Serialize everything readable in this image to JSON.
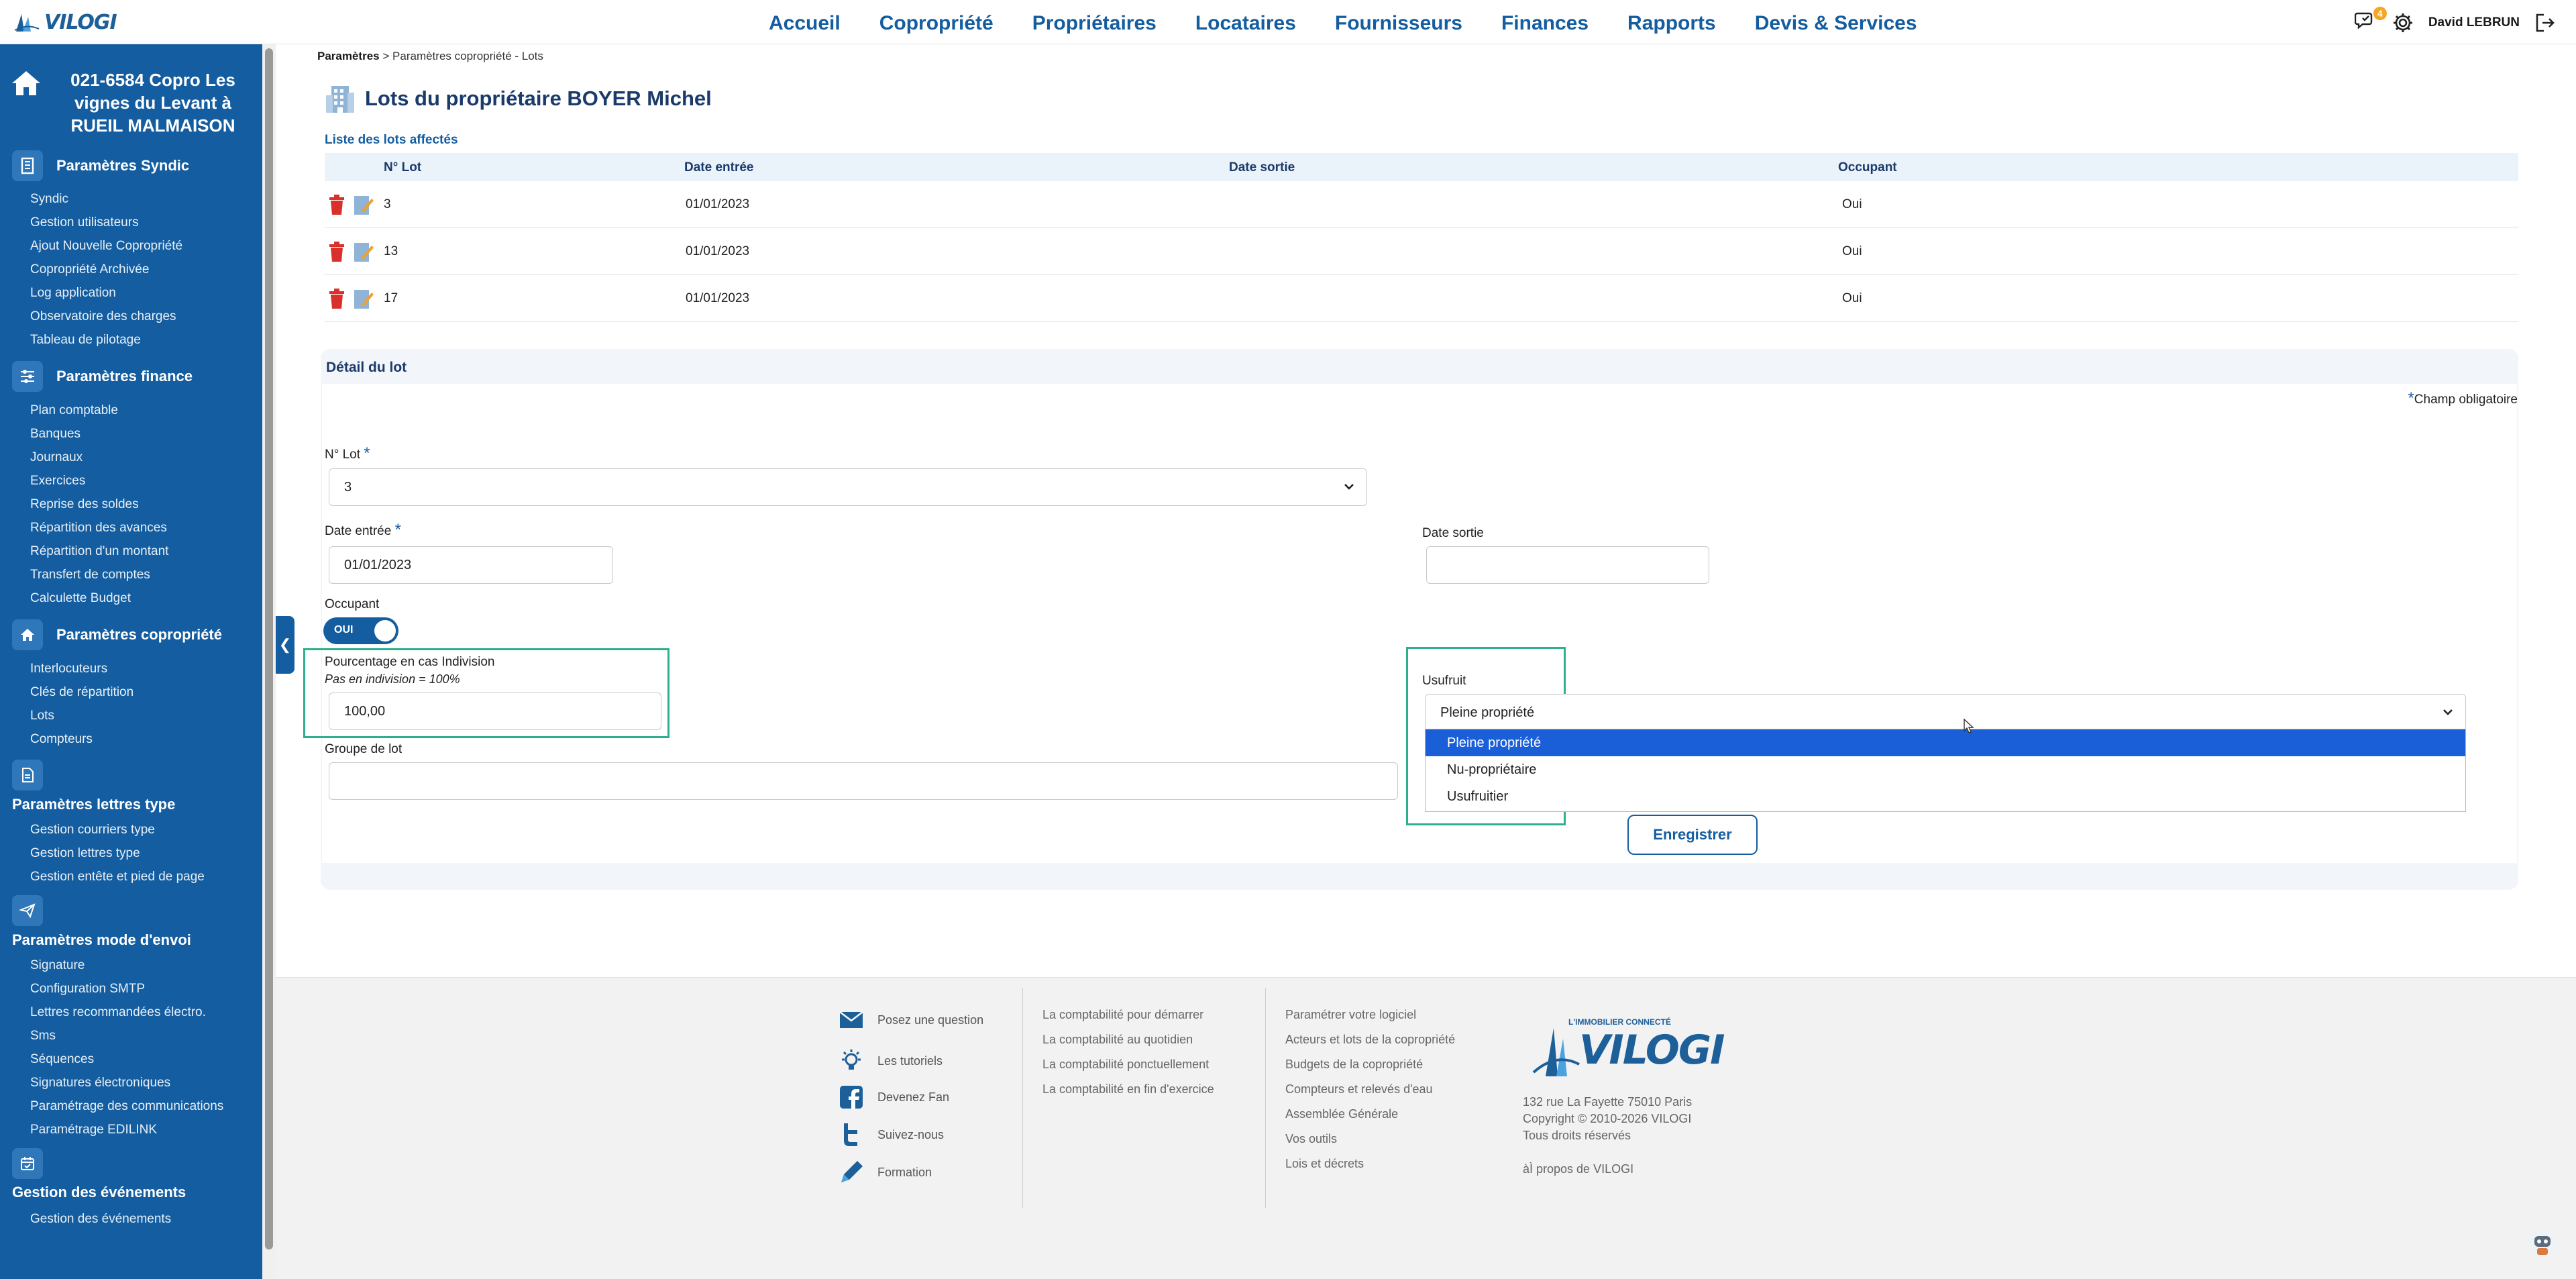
{
  "topnav": {
    "logo": "VILOGI",
    "items": [
      "Accueil",
      "Copropriété",
      "Propriétaires",
      "Locataires",
      "Fournisseurs",
      "Finances",
      "Rapports",
      "Devis & Services"
    ],
    "notification_count": "4",
    "user_name": "David LEBRUN"
  },
  "sidebar": {
    "copro_title": "021-6584 Copro Les vignes du Levant à RUEIL MALMAISON",
    "sections": [
      {
        "title": "Paramètres Syndic",
        "icon": "building-icon",
        "links": [
          "Syndic",
          "Gestion utilisateurs",
          "Ajout Nouvelle Copropriété",
          "Copropriété Archivée",
          "Log application",
          "Observatoire des charges",
          "Tableau de pilotage"
        ]
      },
      {
        "title": "Paramètres finance",
        "icon": "sliders-icon",
        "links": [
          "Plan comptable",
          "Banques",
          "Journaux",
          "Exercices",
          "Reprise des soldes",
          "Répartition des avances",
          "Répartition d'un montant",
          "Transfert de comptes",
          "Calculette Budget"
        ]
      },
      {
        "title": "Paramètres copropriété",
        "icon": "home-icon",
        "links": [
          "Interlocuteurs",
          "Clés de répartition",
          "Lots",
          "Compteurs"
        ]
      },
      {
        "title": "Paramètres lettres type",
        "icon": "document-icon",
        "links": [
          "Gestion courriers type",
          "Gestion lettres type",
          "Gestion entête et pied de page"
        ]
      },
      {
        "title": "Paramètres mode d'envoi",
        "icon": "send-icon",
        "links": [
          "Signature",
          "Configuration SMTP",
          "Lettres recommandées électro.",
          "Sms",
          "Séquences",
          "Signatures électroniques",
          "Paramétrage des communications",
          "Paramétrage EDILINK"
        ]
      },
      {
        "title": "Gestion des événements",
        "icon": "calendar-icon",
        "links": [
          "Gestion des événements"
        ]
      }
    ]
  },
  "breadcrumb": {
    "root": "Paramètres",
    "separator": ">",
    "current": "Paramètres copropriété - Lots"
  },
  "page_title": "Lots du propriétaire BOYER Michel",
  "lots_table": {
    "label": "Liste des lots affectés",
    "headers": [
      "N° Lot",
      "Date entrée",
      "Date sortie",
      "Occupant"
    ],
    "rows": [
      {
        "lot": "3",
        "date_entree": "01/01/2023",
        "date_sortie": "",
        "occupant": "Oui"
      },
      {
        "lot": "13",
        "date_entree": "01/01/2023",
        "date_sortie": "",
        "occupant": "Oui"
      },
      {
        "lot": "17",
        "date_entree": "01/01/2023",
        "date_sortie": "",
        "occupant": "Oui"
      }
    ]
  },
  "detail": {
    "title": "Détail du lot",
    "required_star": "*",
    "required_note": "Champ obligatoire",
    "lot_label": "N° Lot",
    "lot_value": "3",
    "date_entree_label": "Date entrée",
    "date_entree_value": "01/01/2023",
    "date_sortie_label": "Date sortie",
    "date_sortie_value": "",
    "occupant_label": "Occupant",
    "occupant_toggle": "OUI",
    "indivision_label": "Pourcentage en cas Indivision",
    "indivision_hint": "Pas en indivision = 100%",
    "indivision_value": "100,00",
    "groupe_label": "Groupe de lot",
    "groupe_value": "",
    "usufruit_label": "Usufruit",
    "usufruit_value": "Pleine propriété",
    "usufruit_options": [
      "Pleine propriété",
      "Nu-propriétaire",
      "Usufruitier"
    ],
    "save_label": "Enregistrer"
  },
  "footer": {
    "col1": [
      "Posez une question",
      "Les tutoriels",
      "Devenez Fan",
      "Suivez-nous",
      "Formation"
    ],
    "col2": [
      "La comptabilité pour démarrer",
      "La comptabilité au quotidien",
      "La comptabilité ponctuellement",
      "La comptabilité en fin d'exercice"
    ],
    "col3": [
      "Paramétrer votre logiciel",
      "Acteurs et lots de la copropriété",
      "Budgets de la copropriété",
      "Compteurs et relevés d'eau",
      "Assemblée Générale",
      "Vos outils",
      "Lois et décrets"
    ],
    "logo_tagline": "L'IMMOBILIER CONNECTÉ",
    "logo": "VILOGI",
    "address": "132 rue La Fayette 75010 Paris",
    "copyright": "Copyright © 2010-2026 VILOGI",
    "rights": "Tous droits réservés",
    "about": "àÌ propos de VILOGI"
  },
  "colors": {
    "primary": "#145da0",
    "highlight": "#2eaf8d",
    "selected_option": "#1a5fd8",
    "badge": "#f5a623",
    "trash": "#d9302c"
  }
}
